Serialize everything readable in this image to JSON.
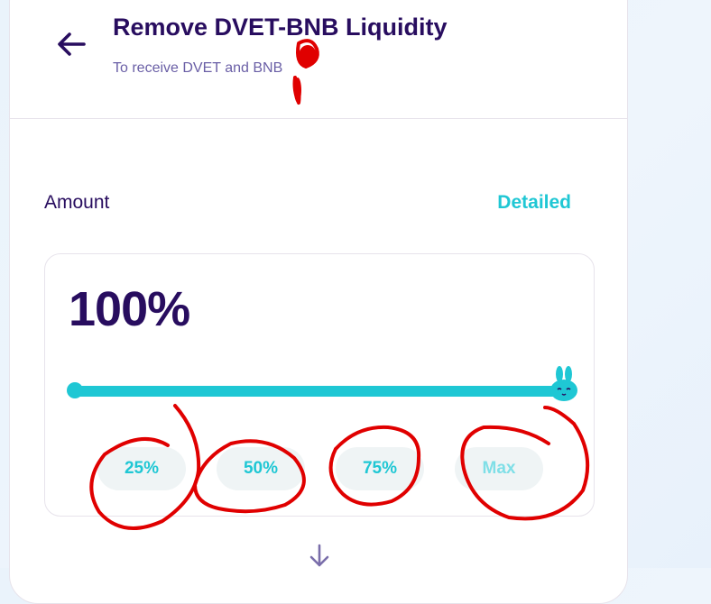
{
  "header": {
    "title": "Remove DVET-BNB Liquidity",
    "subtitle": "To receive DVET and BNB"
  },
  "amount": {
    "label": "Amount",
    "mode_toggle": "Detailed",
    "percent_text": "100%",
    "slider_value_percent": 100
  },
  "percent_buttons": [
    {
      "label": "25%"
    },
    {
      "label": "50%"
    },
    {
      "label": "75%"
    },
    {
      "label": "Max"
    }
  ],
  "colors": {
    "accent": "#1fc7d4",
    "text_primary": "#280d5f",
    "text_secondary": "#6a5fa6",
    "annotation": "#e00000"
  },
  "icons": {
    "back": "arrow-left-icon",
    "slider_thumb": "bunny-icon",
    "next": "arrow-down-icon"
  }
}
